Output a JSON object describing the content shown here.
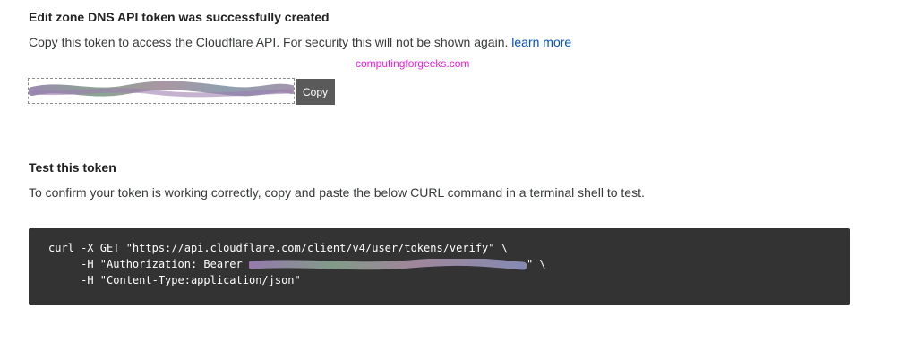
{
  "success": {
    "title": "Edit zone DNS API token was successfully created",
    "description": "Copy this token to access the Cloudflare API. For security this will not be shown again.",
    "learn_more": "learn more"
  },
  "watermark": "computingforgeeks.com",
  "token": {
    "copy_label": "Copy"
  },
  "test": {
    "title": "Test this token",
    "description": "To confirm your token is working correctly, copy and paste the below CURL command in a terminal shell to test."
  },
  "code": {
    "line1": "curl -X GET \"https://api.cloudflare.com/client/v4/user/tokens/verify\" \\",
    "line2_prefix": "     -H \"Authorization: Bearer ",
    "line2_suffix": "\" \\",
    "line3": "     -H \"Content-Type:application/json\""
  },
  "colors": {
    "link": "#0051c3",
    "watermark": "#e81cdc",
    "code_bg": "#333333",
    "copy_button_bg": "#5a5a5a"
  }
}
